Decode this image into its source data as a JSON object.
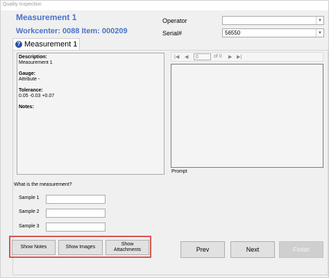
{
  "window": {
    "title": "Quality Inspection"
  },
  "header": {
    "measurement_title": "Measurement 1",
    "workcenter_line": "Workcenter: 0088 Item: 000209"
  },
  "operator": {
    "label": "Operator",
    "value": ""
  },
  "serial": {
    "label": "Serial#",
    "value": "56550"
  },
  "tab": {
    "label": "Measurement 1"
  },
  "description": {
    "description_label": "Description:",
    "description_value": "Measurement 1",
    "gauge_label": "Gauge:",
    "gauge_value": "Attribute -",
    "tolerance_label": "Tolerance:",
    "tolerance_value": "0.05 -0.03 +0.07",
    "notes_label": "Notes:"
  },
  "navigator": {
    "position": "0",
    "count_text": "of 0"
  },
  "prompt": {
    "label": "Prompt"
  },
  "question": "What is the measurement?",
  "samples": [
    {
      "label": "Sample 1",
      "value": ""
    },
    {
      "label": "Sample 2",
      "value": ""
    },
    {
      "label": "Sample 3",
      "value": ""
    }
  ],
  "buttons": {
    "show_notes": "Show Notes",
    "show_images": "Show Images",
    "show_attachments": "Show Attachments",
    "prev": "Prev",
    "next": "Next",
    "finish": "Finish"
  },
  "colors": {
    "heading": "#4a73c8",
    "highlight": "#d9534f"
  }
}
